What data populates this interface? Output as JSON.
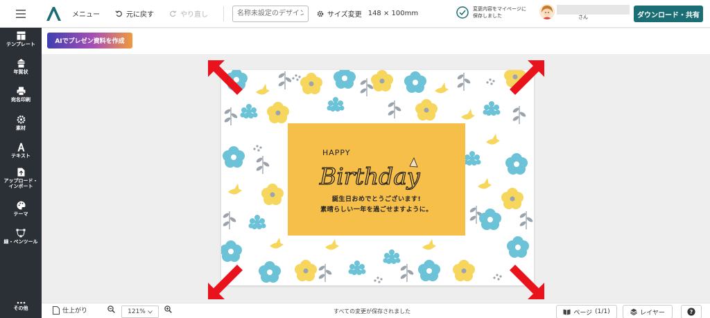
{
  "topbar": {
    "menu_label": "メニュー",
    "undo_label": "元に戻す",
    "redo_label": "やり直し",
    "title_placeholder": "名称未設定のデザイン",
    "size_change_label": "サイズ変更",
    "size_value": "148 × 100mm",
    "saved_note": "変更内容をマイページに保存しました",
    "user_suffix": "さん",
    "download_label": "ダウンロード・共有"
  },
  "sidebar": {
    "items": [
      {
        "label": "テンプレート",
        "icon": "template-icon"
      },
      {
        "label": "年賀状",
        "icon": "new-year-card-icon"
      },
      {
        "label": "宛名印刷",
        "icon": "printer-icon"
      },
      {
        "label": "素材",
        "icon": "materials-icon"
      },
      {
        "label": "テキスト",
        "icon": "text-icon"
      },
      {
        "label": "アップロード・\nインポート",
        "icon": "upload-icon"
      },
      {
        "label": "テーマ",
        "icon": "palette-icon"
      },
      {
        "label": "線・ペンツール",
        "icon": "pen-tool-icon"
      },
      {
        "label": "その他",
        "icon": "more-icon"
      }
    ]
  },
  "subbar": {
    "ai_button_label": "AIでプレゼン資料を作成"
  },
  "card": {
    "happy": "HAPPY",
    "birthday": "Birthday",
    "message_line1": "誕生日おめでとうございます!",
    "message_line2": "素晴らしい一年を過ごせますように。",
    "panel_color": "#f5bf4a"
  },
  "bottombar": {
    "finish_label": "仕上がり",
    "zoom_value": "121%",
    "status": "すべての変更が保存されました",
    "page_label": "ページ",
    "page_count": "(1/1)",
    "layer_label": "レイヤー",
    "help_label": "?"
  },
  "colors": {
    "accent": "#1b6f74",
    "sidebar_bg": "#2b2f36",
    "arrow": "#e8131c"
  }
}
